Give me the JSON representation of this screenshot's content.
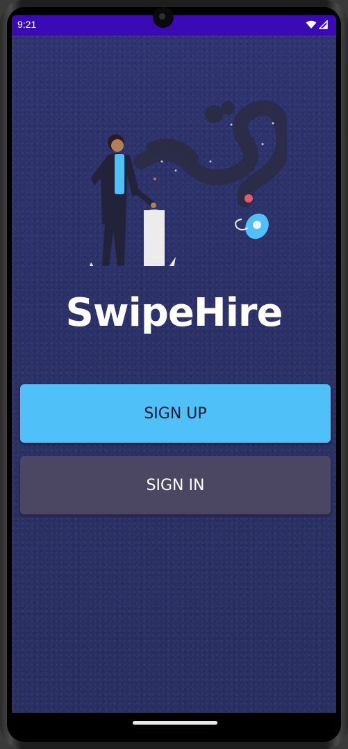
{
  "status_bar": {
    "time": "9:21",
    "icons": [
      "wifi-icon",
      "cell-signal-icon"
    ]
  },
  "app": {
    "title": "SwipeHire",
    "illustration": "person-launching-rocket-illustration"
  },
  "buttons": {
    "sign_up": "SIGN UP",
    "sign_in": "SIGN IN"
  },
  "colors": {
    "status_bar": "#3a0bb5",
    "background": "#2b3065",
    "sign_up_button": "#4fc0f8",
    "sign_in_button": "#4b4763",
    "title_text": "#ffffff"
  }
}
